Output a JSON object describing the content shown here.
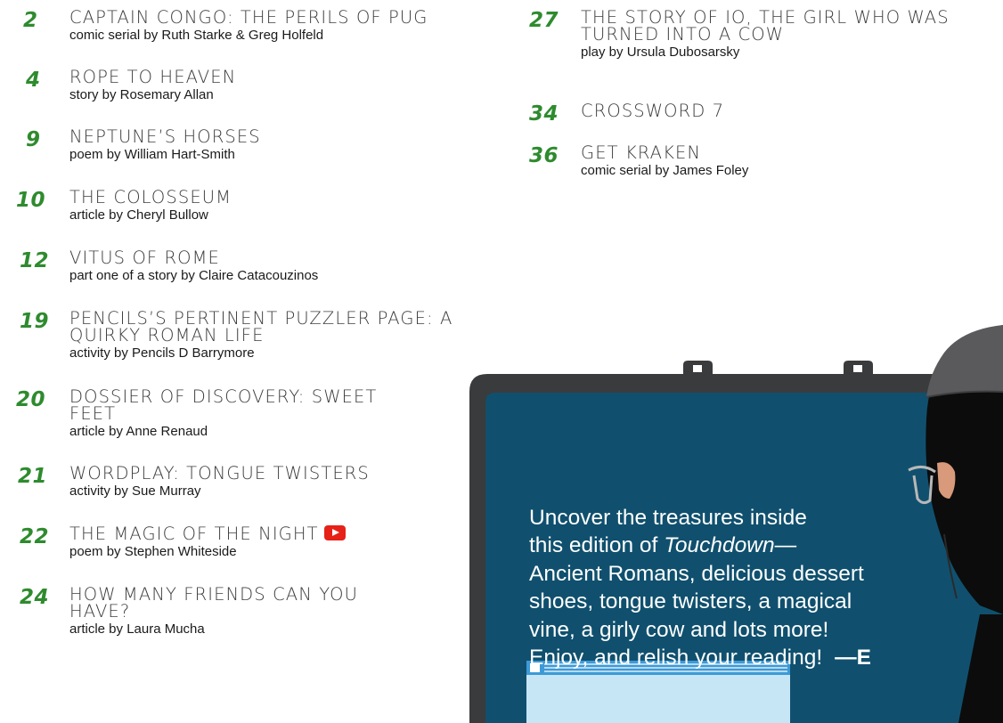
{
  "contents": [
    {
      "page": "2",
      "title": "CAPTAIN CONGO: THE PERILS OF PUG",
      "byline": "comic serial by Ruth Starke & Greg Holfeld"
    },
    {
      "page": "4",
      "title": "ROPE TO HEAVEN",
      "byline": "story by Rosemary Allan"
    },
    {
      "page": "9",
      "title": "NEPTUNE’S HORSES",
      "byline": "poem by William Hart-Smith"
    },
    {
      "page": "10",
      "title": "THE COLOSSEUM",
      "byline": "article by Cheryl Bullow"
    },
    {
      "page": "12",
      "title": "VITUS OF ROME",
      "byline": "part one of a story by Claire Catacouzinos"
    },
    {
      "page": "19",
      "title": "PENCILS’S PERTINENT PUZZLER PAGE: A QUIRKY ROMAN LIFE",
      "byline": "activity by Pencils D Barrymore"
    },
    {
      "page": "20",
      "title": "DOSSIER OF DISCOVERY: SWEET FEET",
      "byline": "article by Anne Renaud"
    },
    {
      "page": "21",
      "title": "WORDPLAY: TONGUE TWISTERS",
      "byline": "activity by Sue Murray"
    },
    {
      "page": "22",
      "title": "THE MAGIC OF THE NIGHT",
      "byline": "poem by Stephen Whiteside"
    },
    {
      "page": "24",
      "title": "HOW MANY FRIENDS CAN YOU HAVE?",
      "byline": "article by Laura Mucha"
    },
    {
      "page": "27",
      "title": "THE STORY OF IO, THE GIRL WHO WAS TURNED INTO A COW",
      "byline": "play by Ursula Dubosarsky"
    },
    {
      "page": "34",
      "title": "CROSSWORD 7",
      "byline": ""
    },
    {
      "page": "36",
      "title": "GET KRAKEN",
      "byline": "comic serial by James Foley"
    }
  ],
  "intro": {
    "line1": "Uncover the treasures inside",
    "line2_before": "this edition of ",
    "line2_italic": "Touchdown",
    "line2_after": "—",
    "line3": "Ancient Romans, delicious dessert",
    "line4": "shoes, tongue twisters, a magical",
    "line5": "vine, a girly cow and lots more!",
    "line6": "Enjoy, and relish your reading!",
    "signature": "—E"
  },
  "video_icon": "youtube-play-icon",
  "colors": {
    "page_number": "#2e8b2e",
    "screen": "#10506e",
    "bezel": "#3a3b3c"
  }
}
